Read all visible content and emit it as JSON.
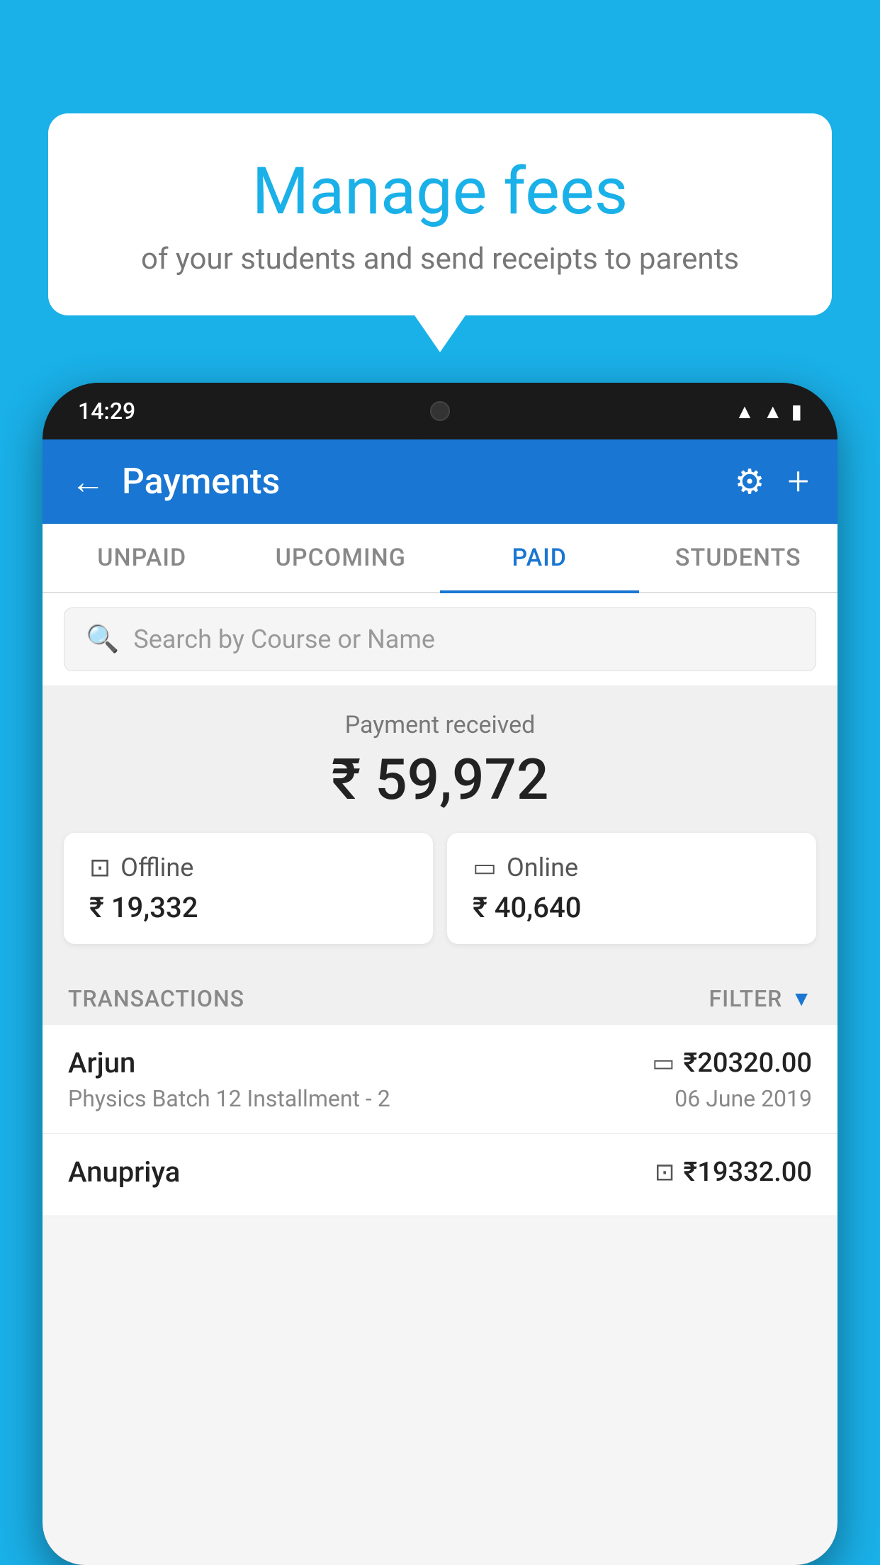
{
  "background_color": "#1ab0e8",
  "speech_bubble": {
    "title": "Manage fees",
    "subtitle": "of your students and send receipts to parents"
  },
  "status_bar": {
    "time": "14:29",
    "wifi": "▲",
    "signal": "▲",
    "battery": "▪"
  },
  "header": {
    "title": "Payments",
    "back_label": "←",
    "gear_label": "⚙",
    "plus_label": "+"
  },
  "tabs": [
    {
      "id": "unpaid",
      "label": "UNPAID",
      "active": false
    },
    {
      "id": "upcoming",
      "label": "UPCOMING",
      "active": false
    },
    {
      "id": "paid",
      "label": "PAID",
      "active": true
    },
    {
      "id": "students",
      "label": "STUDENTS",
      "active": false
    }
  ],
  "search": {
    "placeholder": "Search by Course or Name"
  },
  "payment_section": {
    "label": "Payment received",
    "total_amount": "₹ 59,972",
    "offline": {
      "label": "Offline",
      "amount": "₹ 19,332"
    },
    "online": {
      "label": "Online",
      "amount": "₹ 40,640"
    }
  },
  "transactions": {
    "header_label": "TRANSACTIONS",
    "filter_label": "FILTER",
    "items": [
      {
        "name": "Arjun",
        "course": "Physics Batch 12 Installment - 2",
        "amount": "₹20320.00",
        "date": "06 June 2019",
        "type": "online"
      },
      {
        "name": "Anupriya",
        "course": "",
        "amount": "₹19332.00",
        "date": "",
        "type": "offline"
      }
    ]
  },
  "icons": {
    "back": "←",
    "gear": "⚙",
    "plus": "+",
    "search": "🔍",
    "offline_payment": "🪙",
    "online_payment": "💳",
    "filter": "▼"
  }
}
